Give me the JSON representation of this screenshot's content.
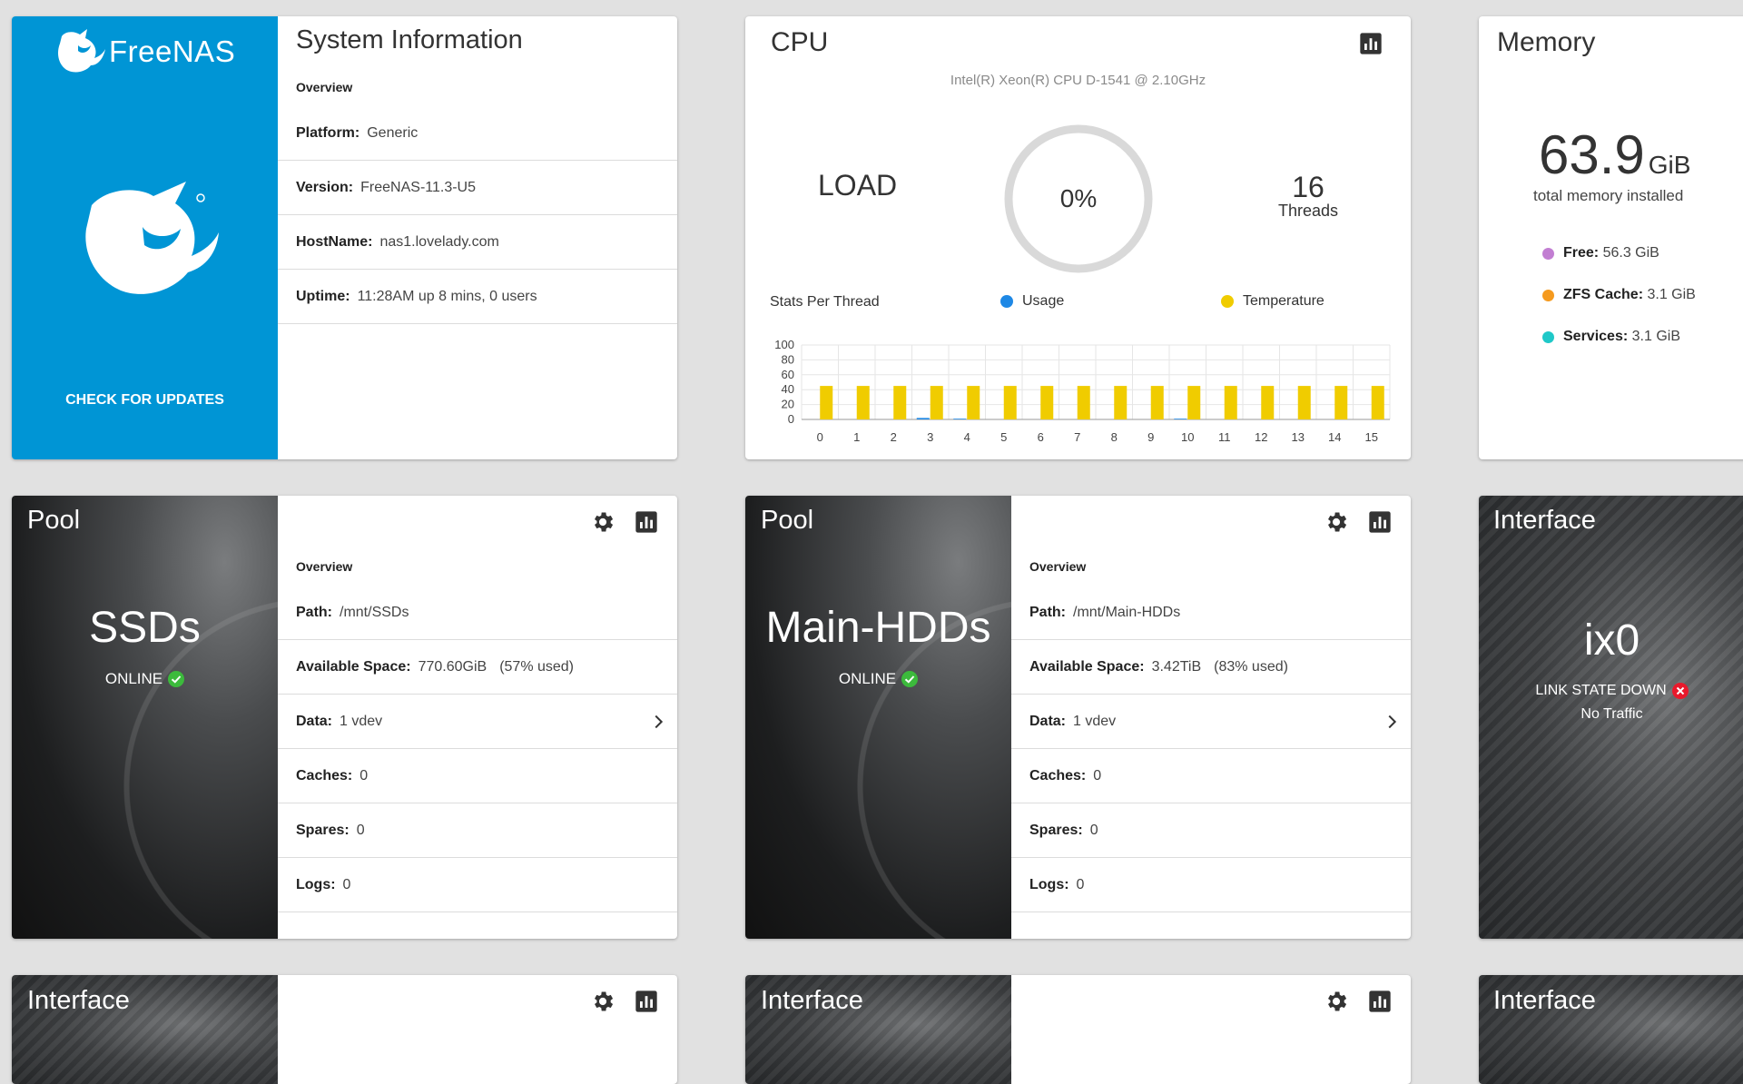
{
  "system": {
    "logo_text": "FreeNAS",
    "check_updates": "CHECK FOR UPDATES",
    "title": "System Information",
    "overview": "Overview",
    "rows": [
      {
        "label": "Platform:",
        "value": "Generic"
      },
      {
        "label": "Version:",
        "value": "FreeNAS-11.3-U5"
      },
      {
        "label": "HostName:",
        "value": "nas1.lovelady.com"
      },
      {
        "label": "Uptime:",
        "value": "11:28AM up 8 mins, 0 users"
      }
    ]
  },
  "cpu": {
    "title": "CPU",
    "model": "Intel(R) Xeon(R) CPU D-1541 @ 2.10GHz",
    "load_label": "LOAD",
    "load_value": "0%",
    "threads_count": "16",
    "threads_label": "Threads",
    "stats_label": "Stats Per Thread",
    "legend": [
      {
        "label": "Usage",
        "color": "#1e88e5"
      },
      {
        "label": "Temperature",
        "color": "#f0cc00"
      }
    ]
  },
  "chart_data": {
    "type": "bar",
    "categories": [
      "0",
      "1",
      "2",
      "3",
      "4",
      "5",
      "6",
      "7",
      "8",
      "9",
      "10",
      "11",
      "12",
      "13",
      "14",
      "15"
    ],
    "series": [
      {
        "name": "Usage",
        "values": [
          0,
          0,
          0,
          2,
          1,
          0,
          0,
          0,
          0,
          0,
          1,
          0,
          0,
          0,
          0,
          0
        ]
      },
      {
        "name": "Temperature",
        "values": [
          45,
          45,
          45,
          45,
          45,
          45,
          45,
          45,
          45,
          45,
          45,
          45,
          45,
          45,
          45,
          45
        ]
      }
    ],
    "yticks": [
      "100",
      "80",
      "60",
      "40",
      "20",
      "0"
    ],
    "ylim": [
      0,
      100
    ],
    "grid": true,
    "legend": "top"
  },
  "memory": {
    "title": "Memory",
    "total": "63.9",
    "unit": "GiB",
    "caption": "total memory installed",
    "items": [
      {
        "label": "Free:",
        "value": "56.3 GiB",
        "color": "#c27ed2"
      },
      {
        "label": "ZFS Cache:",
        "value": "3.1 GiB",
        "color": "#f59a1e"
      },
      {
        "label": "Services:",
        "value": "3.1 GiB",
        "color": "#1fc8c8"
      }
    ]
  },
  "pools": [
    {
      "panel_title": "Pool",
      "name": "SSDs",
      "status": "ONLINE",
      "overview": "Overview",
      "rows": [
        {
          "label": "Path:",
          "value": "/mnt/SSDs"
        },
        {
          "label": "Available Space:",
          "value": "770.60GiB",
          "extra": "(57% used)"
        },
        {
          "label": "Data:",
          "value": "1 vdev"
        },
        {
          "label": "Caches:",
          "value": "0"
        },
        {
          "label": "Spares:",
          "value": "0"
        },
        {
          "label": "Logs:",
          "value": "0"
        }
      ]
    },
    {
      "panel_title": "Pool",
      "name": "Main-HDDs",
      "status": "ONLINE",
      "overview": "Overview",
      "rows": [
        {
          "label": "Path:",
          "value": "/mnt/Main-HDDs"
        },
        {
          "label": "Available Space:",
          "value": "3.42TiB",
          "extra": "(83% used)"
        },
        {
          "label": "Data:",
          "value": "1 vdev"
        },
        {
          "label": "Caches:",
          "value": "0"
        },
        {
          "label": "Spares:",
          "value": "0"
        },
        {
          "label": "Logs:",
          "value": "0"
        }
      ]
    }
  ],
  "interface": {
    "title": "Interface",
    "name": "ix0",
    "link_state": "LINK STATE DOWN",
    "traffic": "No Traffic"
  },
  "bottom": [
    {
      "title": "Interface"
    },
    {
      "title": "Interface"
    },
    {
      "title": "Interface"
    }
  ],
  "colors": {
    "accent": "#0095d5",
    "online": "#3cba3c",
    "down": "#e8192c"
  }
}
